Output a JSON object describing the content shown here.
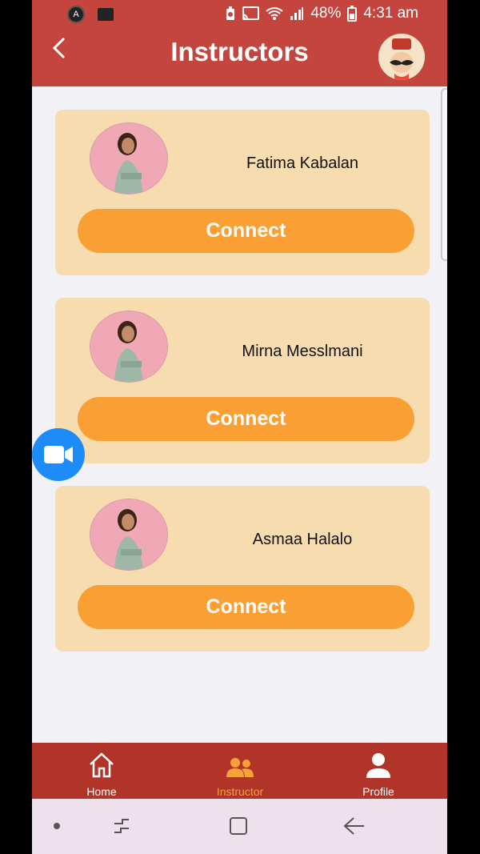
{
  "status_bar": {
    "battery": "48%",
    "time": "4:31 am",
    "icons": [
      "app-circle-icon",
      "folder-icon",
      "battery-saver-icon",
      "cast-icon",
      "wifi-icon",
      "signal-icon"
    ]
  },
  "header": {
    "title": "Instructors",
    "back_icon": "chevron-left-icon",
    "avatar_icon": "mustache-avatar-icon"
  },
  "instructors": [
    {
      "name": "Fatima Kabalan",
      "button": "Connect"
    },
    {
      "name": "Mirna Messlmani",
      "button": "Connect"
    },
    {
      "name": "Asmaa Halalo",
      "button": "Connect"
    }
  ],
  "fab": {
    "icon": "video-camera-icon"
  },
  "bottom_nav": {
    "items": [
      {
        "label": "Home",
        "icon": "home-icon",
        "active": false
      },
      {
        "label": "Instructor",
        "icon": "group-icon",
        "active": true
      },
      {
        "label": "Profile",
        "icon": "person-icon",
        "active": false
      }
    ]
  },
  "colors": {
    "header": "#c4453d",
    "card": "#f7dcaf",
    "button": "#fa9f33",
    "nav": "#b03428",
    "active_nav": "#f6a23a",
    "fab": "#1d8cf8"
  }
}
